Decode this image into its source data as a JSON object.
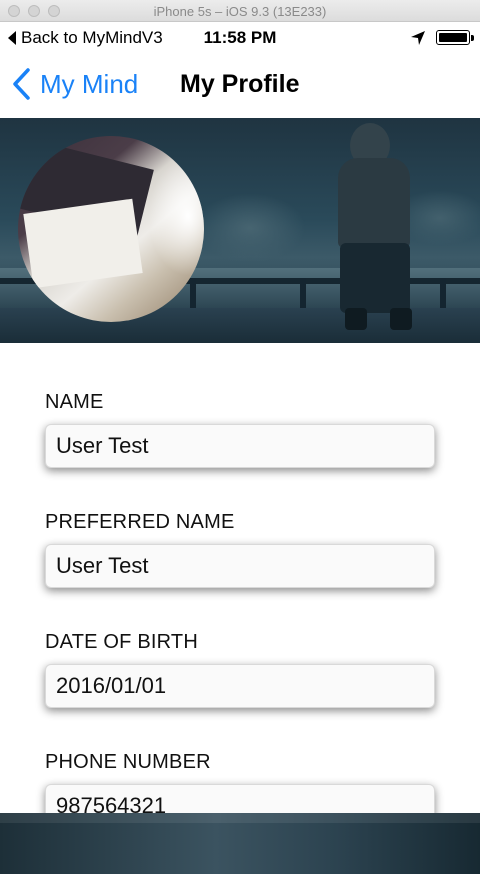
{
  "simulator": {
    "title": "iPhone 5s – iOS 9.3 (13E233)"
  },
  "status_bar": {
    "back_app_label": "Back to MyMindV3",
    "time": "11:58 PM"
  },
  "nav": {
    "back_label": "My Mind",
    "title": "My Profile"
  },
  "form": {
    "fields": [
      {
        "label": "NAME",
        "value": "User Test"
      },
      {
        "label": "PREFERRED NAME",
        "value": "User Test"
      },
      {
        "label": "DATE OF BIRTH",
        "value": "2016/01/01"
      },
      {
        "label": "PHONE NUMBER",
        "value": "987564321"
      }
    ]
  },
  "colors": {
    "accent": "#1a82f7",
    "banner": "#2a4a5a"
  }
}
